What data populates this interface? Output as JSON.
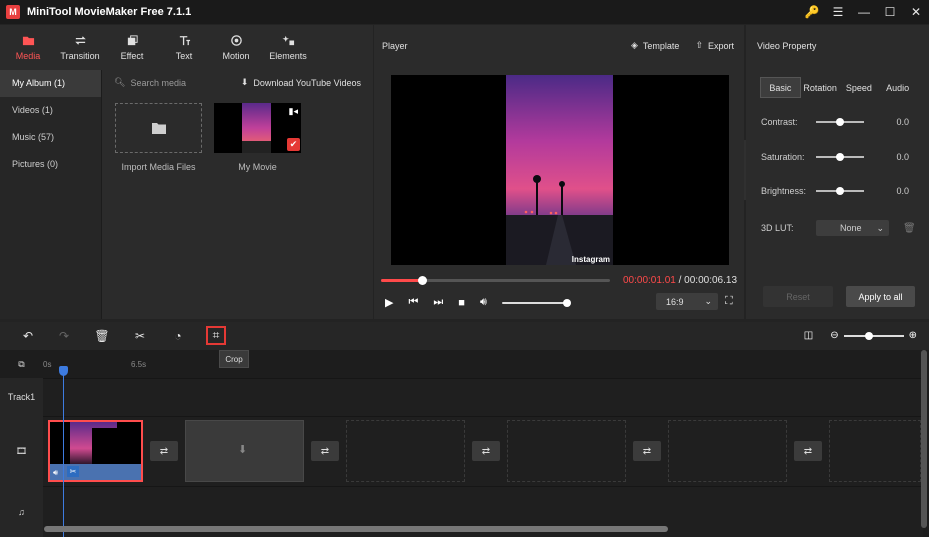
{
  "app": {
    "title": "MiniTool MovieMaker Free 7.1.1",
    "logo_letter": "M"
  },
  "window_buttons": {
    "key": "🔑",
    "menu": "☰",
    "minimize": "—",
    "maximize": "☐",
    "close": "✕"
  },
  "media_tabs": [
    {
      "label": "Media",
      "icon": "folder-icon",
      "active": true
    },
    {
      "label": "Transition",
      "icon": "transition-icon"
    },
    {
      "label": "Effect",
      "icon": "effect-icon"
    },
    {
      "label": "Text",
      "icon": "text-icon"
    },
    {
      "label": "Motion",
      "icon": "motion-icon"
    },
    {
      "label": "Elements",
      "icon": "elements-icon"
    }
  ],
  "albums": [
    {
      "label": "My Album (1)",
      "active": true
    },
    {
      "label": "Videos (1)"
    },
    {
      "label": "Music (57)"
    },
    {
      "label": "Pictures (0)"
    }
  ],
  "media": {
    "search_placeholder": "Search media",
    "youtube_label": "Download YouTube Videos",
    "import_label": "Import Media Files",
    "movie_label": "My Movie"
  },
  "player": {
    "title": "Player",
    "template_label": "Template",
    "export_label": "Export",
    "watermark": "Instagram",
    "current_time": "00:00:01.01",
    "separator": " / ",
    "total_time": "00:00:06.13",
    "progress_fraction": 0.18,
    "aspect_ratio": "16:9"
  },
  "property": {
    "title": "Video Property",
    "tabs": [
      "Basic",
      "Rotation",
      "Speed",
      "Audio"
    ],
    "active_tab": "Basic",
    "rows": [
      {
        "label": "Contrast:",
        "value": "0.0"
      },
      {
        "label": "Saturation:",
        "value": "0.0"
      },
      {
        "label": "Brightness:",
        "value": "0.0"
      }
    ],
    "lut_label": "3D LUT:",
    "lut_value": "None",
    "reset_label": "Reset",
    "apply_label": "Apply to all"
  },
  "timeline": {
    "tooltip": "Crop",
    "ruler": [
      "0s",
      "6.5s"
    ],
    "track_label": "Track1"
  },
  "colors": {
    "accent": "#ff4a4a",
    "playhead": "#3d7be0",
    "bg": "#232323"
  }
}
